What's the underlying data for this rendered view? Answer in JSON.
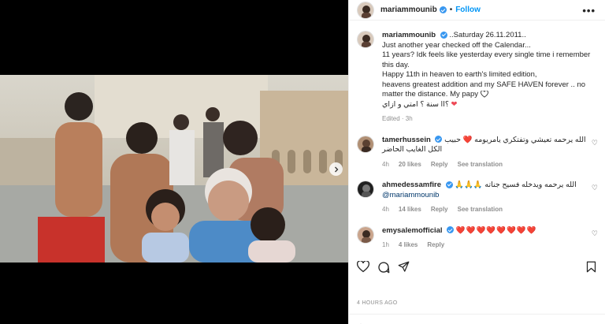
{
  "colors": {
    "accent": "#0095f6",
    "verified": "#3897f0",
    "heart": "#ed4956",
    "muted": "#8e8e8e"
  },
  "header": {
    "username": "mariammounib",
    "separator": "•",
    "follow_label": "Follow",
    "more_icon": "more-horizontal-icon"
  },
  "caption": {
    "username": "mariammounib",
    "line1": "..Saturday 26.11.2011..",
    "line2": "Just another year checked off the Calendar...",
    "line3": "11 years? Idk feels like yesterday every single time i remember this day.",
    "line4": "Happy 11th in heaven to earth's limited edition,",
    "line5": "heavens greatest addition and my SAFE HAVEN forever .. no matter the distance. My papy",
    "line6": "؟اا سنة ؟ امتي و ازاي",
    "edited": "Edited · 3h"
  },
  "comments": [
    {
      "username": "tamerhussein",
      "text": "الله يرحمه تعيشي وتفتكري يامريومه ❤️ حبيب الكل الغايب الحاضر",
      "time": "4h",
      "likes": "20 likes",
      "reply": "Reply",
      "translation": "See translation"
    },
    {
      "username": "ahmedessamfire",
      "text": "الله يرحمه ويدخله فسيح جناته 🙏🙏🙏",
      "mention": "@mariammounib",
      "time": "4h",
      "likes": "14 likes",
      "reply": "Reply",
      "translation": "See translation"
    },
    {
      "username": "emysalemofficial",
      "text": "❤️❤️❤️❤️❤️❤️❤️❤️",
      "time": "1h",
      "likes": "4 likes",
      "reply": "Reply"
    }
  ],
  "post_time": "4 HOURS AGO"
}
